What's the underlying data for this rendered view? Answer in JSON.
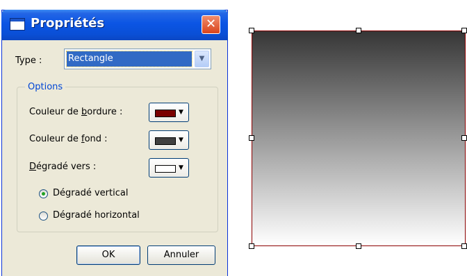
{
  "dialog": {
    "title": "Propriétés",
    "close_glyph": "✕",
    "type_label": "Type :",
    "type_value": "Rectangle",
    "options_label": "Options",
    "border_color": {
      "label_before": "Couleur de ",
      "label_accel": "b",
      "label_after": "ordure :",
      "value": "#7a0000"
    },
    "fill_color": {
      "label_before": "Couleur de ",
      "label_accel": "f",
      "label_after": "ond :",
      "value": "#404040"
    },
    "gradient_to": {
      "label_accel": "D",
      "label_after": "égradé vers :",
      "value": "#ffffff"
    },
    "radio_vertical": "Dégradé vertical",
    "radio_horizontal": "Dégradé horizontal",
    "selected_gradient": "vertical",
    "ok_label": "OK",
    "cancel_label": "Annuler"
  },
  "canvas": {
    "shape_type": "Rectangle",
    "border_color": "#8b0000",
    "gradient_from": "#363636",
    "gradient_to": "#ffffff",
    "gradient_direction": "vertical"
  }
}
